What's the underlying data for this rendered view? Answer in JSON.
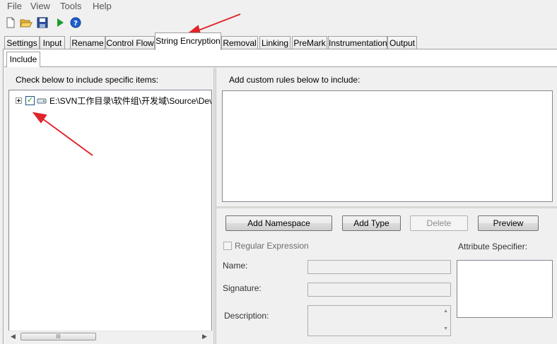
{
  "menu": [
    "File",
    "View",
    "Tools",
    "Help"
  ],
  "tabs": [
    "Settings",
    "Input",
    "Rename",
    "Control Flow",
    "String Encryption",
    "Removal",
    "Linking",
    "PreMark",
    "Instrumentation",
    "Output"
  ],
  "active_tab": "String Encryption",
  "subtab": "Include",
  "left_panel": {
    "label": "Check below to include specific items:",
    "tree_item": "E:\\SVN工作目录\\软件组\\开发域\\Source\\Dev",
    "scroll_thumb": "III"
  },
  "right_panel": {
    "label": "Add custom rules below to include:",
    "buttons": {
      "add_namespace": "Add Namespace",
      "add_type": "Add Type",
      "delete": "Delete",
      "preview": "Preview"
    },
    "regex_label": "Regular Expression",
    "attribute_label": "Attribute Specifier:",
    "name_label": "Name:",
    "signature_label": "Signature:",
    "description_label": "Description:"
  },
  "colors": {
    "arrow": "#e0242b",
    "toolbar_run": "#1f9b2a",
    "toolbar_help": "#1f5fcf"
  }
}
